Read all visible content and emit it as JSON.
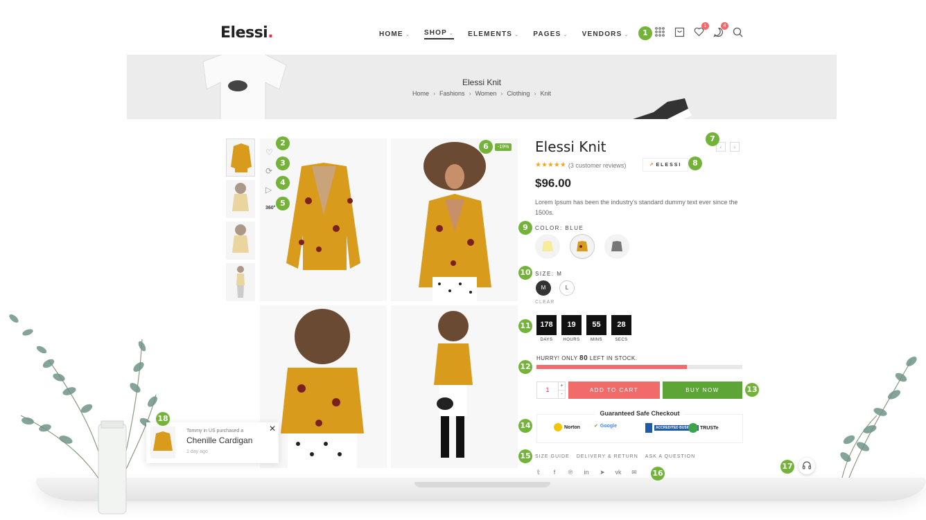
{
  "header": {
    "logo_text": "Elessi",
    "logo_dot": ".",
    "nav": [
      "HOME",
      "SHOP",
      "ELEMENTS",
      "PAGES",
      "VENDORS"
    ],
    "wishlist_count": "1",
    "compare_count": "4"
  },
  "banner": {
    "title": "Elessi Knit",
    "breadcrumb": [
      "Home",
      "Fashions",
      "Women",
      "Clothing",
      "Knit"
    ]
  },
  "gallery": {
    "side_action_360": "360°",
    "sale_badge": "-19%"
  },
  "product": {
    "title": "Elessi Knit",
    "reviews": "(3 customer reviews)",
    "brand": "ELESSI",
    "price": "$96.00",
    "description": "Lorem Ipsum has been the industry's standard dummy text ever since the 1500s.",
    "color_label": "COLOR:",
    "color_value": "BLUE",
    "size_label": "SIZE:",
    "size_value": "M",
    "sizes": [
      "M",
      "L"
    ],
    "clear": "CLEAR",
    "countdown": [
      {
        "num": "178",
        "label": "DAYS"
      },
      {
        "num": "19",
        "label": "HOURS"
      },
      {
        "num": "55",
        "label": "MINS"
      },
      {
        "num": "28",
        "label": "SECS"
      }
    ],
    "stock_prefix": "HURRY! ONLY",
    "stock_count": "80",
    "stock_suffix": "LEFT IN STOCK.",
    "stock_fraction": 0.73,
    "qty": "1",
    "qty_plus": "+",
    "qty_minus": "-",
    "add_to_cart": "ADD TO CART",
    "buy_now": "BUY NOW",
    "checkout_title": "Guaranteed Safe Checkout",
    "trust_badges": [
      "Norton",
      "Google",
      "ACCREDITED BUSINESS",
      "TRUSTe"
    ],
    "links": [
      "SIZE GUIDE",
      "DELIVERY & RETURN",
      "ASK A QUESTION"
    ],
    "social": [
      "twitter-icon",
      "facebook-icon",
      "pinterest-icon",
      "linkedin-icon",
      "telegram-icon",
      "vk-icon",
      "email-icon"
    ]
  },
  "notification": {
    "line1": "Tommy in US purchased a",
    "product": "Chenille Cardigan",
    "time": "1 day ago"
  },
  "markers": [
    "1",
    "2",
    "3",
    "4",
    "5",
    "6",
    "7",
    "8",
    "9",
    "10",
    "11",
    "12",
    "13",
    "14",
    "15",
    "16",
    "17",
    "18"
  ],
  "colors": {
    "accent_green": "#74b33a",
    "sale_red": "#f26b6b",
    "buy_green": "#5ea537",
    "logo_dot": "#e0323c"
  }
}
